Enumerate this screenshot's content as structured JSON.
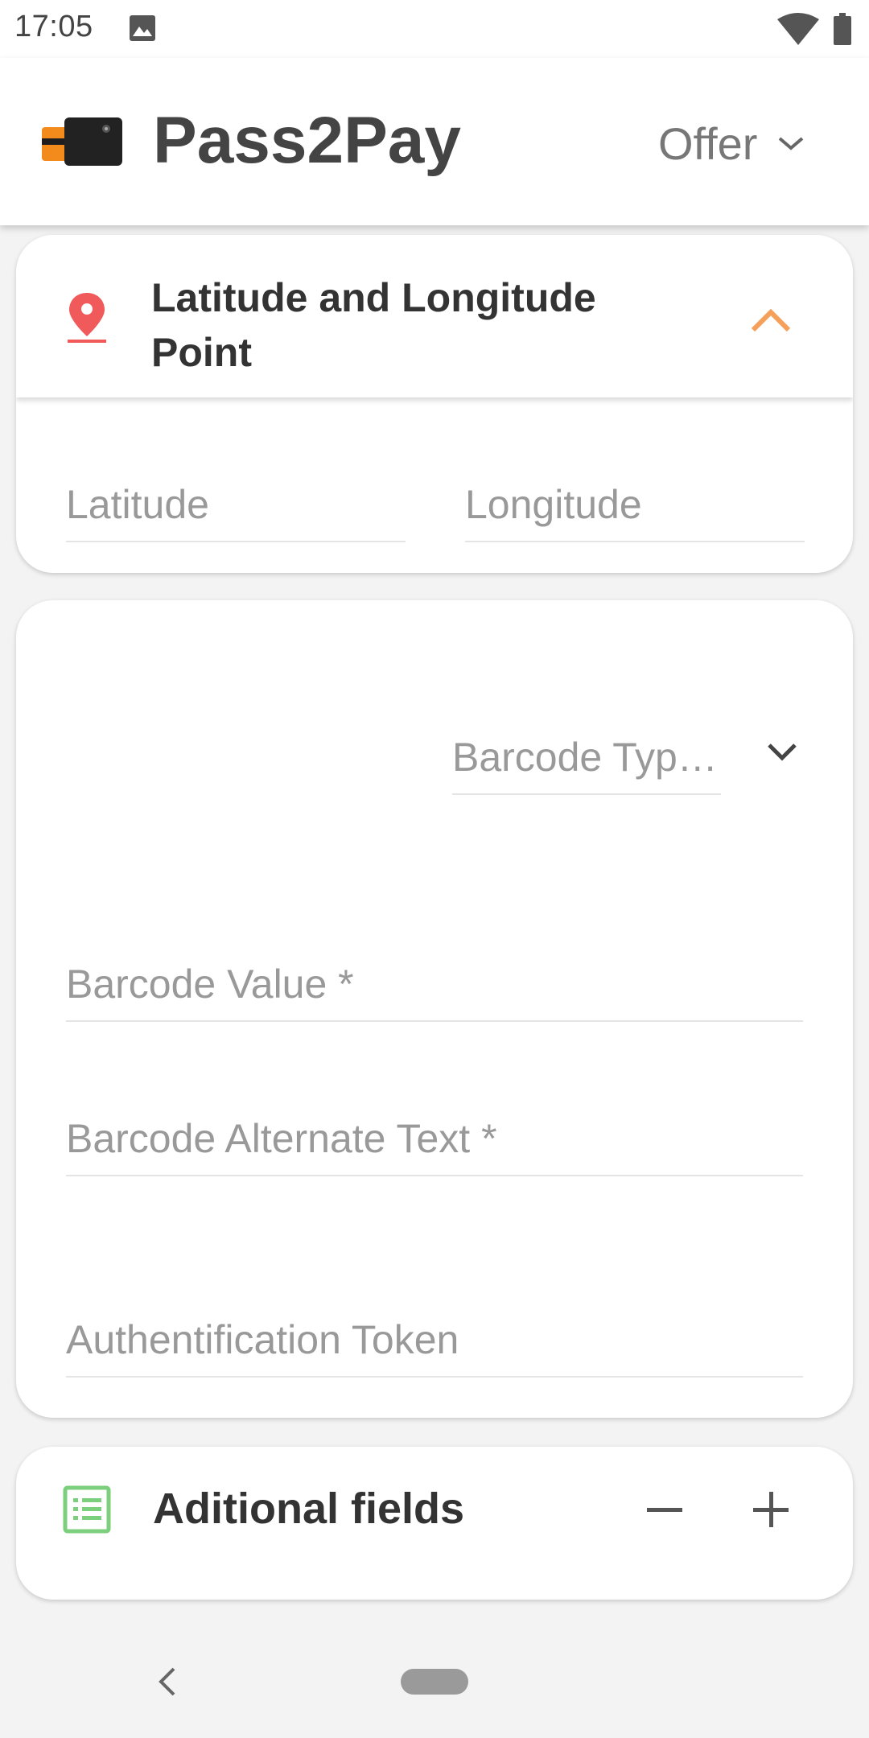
{
  "status_bar": {
    "time": "17:05"
  },
  "app_bar": {
    "title": "Pass2Pay",
    "pass_type": "Offer"
  },
  "location_card": {
    "title": "Latitude and Longitude Point",
    "latitude_placeholder": "Latitude",
    "longitude_placeholder": "Longitude"
  },
  "barcode_card": {
    "barcode_type_placeholder": "Barcode Typ…",
    "barcode_value_placeholder": "Barcode Value *",
    "barcode_alt_text_placeholder": "Barcode Alternate Text *",
    "auth_token_placeholder": "Authentification Token"
  },
  "additional_fields_card": {
    "title": "Aditional fields"
  },
  "colors": {
    "accent_orange": "#f5a05a",
    "pin_red": "#f05a5a",
    "list_green": "#7ccf7c"
  }
}
